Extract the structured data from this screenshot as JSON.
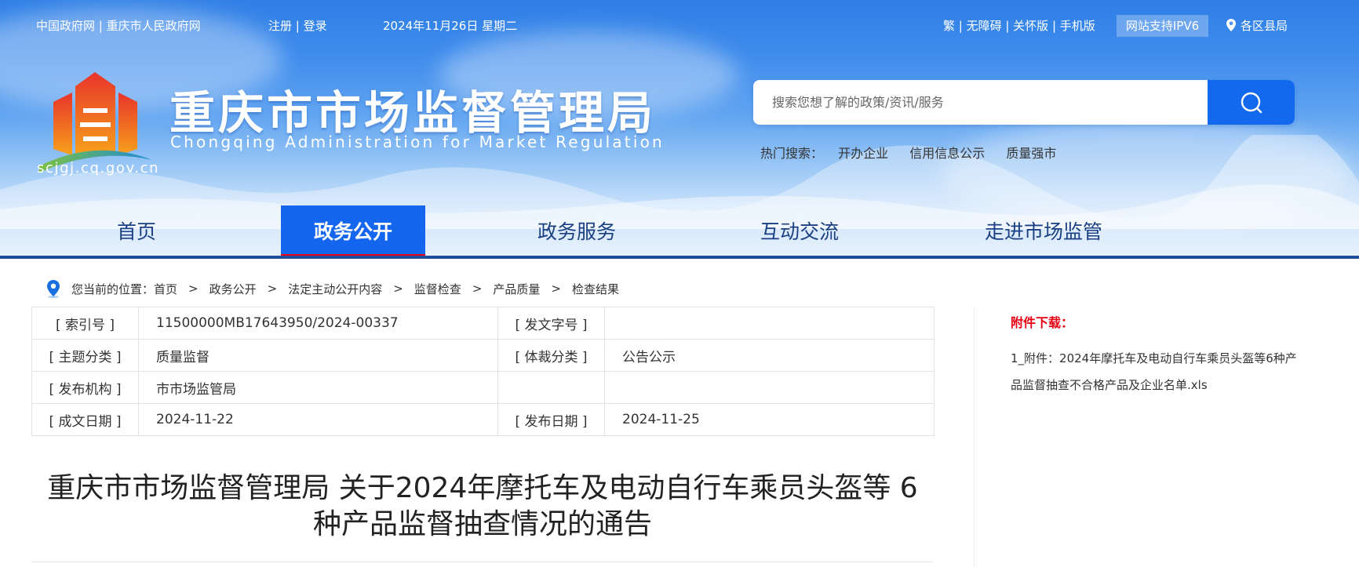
{
  "topbar": {
    "gov_links": "中国政府网 | 重庆市人民政府网",
    "auth_links": "注册 | 登录",
    "date": "2024年11月26日 星期二",
    "tools": "繁 | 无障碍 | 关怀版 | 手机版",
    "ipv6": "网站支持IPV6",
    "districts": "各区县局"
  },
  "brand": {
    "title": "重庆市市场监督管理局",
    "english": "Chongqing  Administration for Market Regulation",
    "domain": "scjgj.cq.gov.cn"
  },
  "search": {
    "placeholder": "搜索您想了解的政策/资讯/服务",
    "hot_label": "热门搜索：",
    "hot_terms": [
      "开办企业",
      "信用信息公示",
      "质量强市"
    ]
  },
  "nav": {
    "items": [
      {
        "label": "首页"
      },
      {
        "label": "政务公开"
      },
      {
        "label": "政务服务"
      },
      {
        "label": "互动交流"
      },
      {
        "label": "走进市场监管"
      }
    ]
  },
  "breadcrumb": {
    "prefix": "您当前的位置：",
    "items": [
      "首页",
      "政务公开",
      "法定主动公开内容",
      "监督检查",
      "产品质量",
      "检查结果"
    ]
  },
  "meta": {
    "rows": [
      {
        "l1": "[ 索引号 ]",
        "v1": "11500000MB17643950/2024-00337",
        "l2": "[ 发文字号 ]",
        "v2": ""
      },
      {
        "l1": "[ 主题分类 ]",
        "v1": "质量监督",
        "l2": "[ 体裁分类 ]",
        "v2": "公告公示"
      },
      {
        "l1": "[ 发布机构 ]",
        "v1": "市市场监管局",
        "l2": "",
        "v2": ""
      },
      {
        "l1": "[ 成文日期 ]",
        "v1": "2024-11-22",
        "l2": "[ 发布日期 ]",
        "v2": "2024-11-25"
      }
    ]
  },
  "article": {
    "title_line1": "重庆市市场监督管理局 关于2024年摩托车及电动自行车乘员头盔等 6",
    "title_line2": "种产品监督抽查情况的通告"
  },
  "attachments": {
    "title": "附件下载：",
    "items": [
      "1_附件：2024年摩托车及电动自行车乘员头盔等6种产品监督抽查不合格产品及企业名单.xls"
    ]
  },
  "colors": {
    "brand_blue": "#1466ee",
    "nav_text": "#1a3f82",
    "accent_red": "#e60012"
  }
}
